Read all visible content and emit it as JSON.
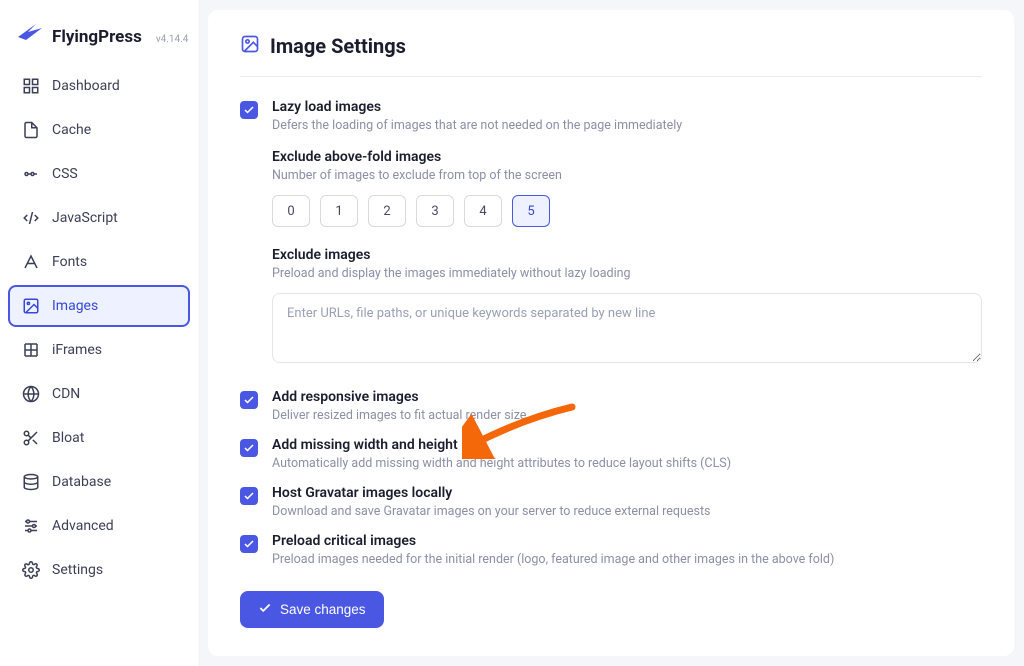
{
  "brand": {
    "name": "FlyingPress",
    "version": "v4.14.4"
  },
  "nav": [
    {
      "label": "Dashboard",
      "icon": "grid"
    },
    {
      "label": "Cache",
      "icon": "file"
    },
    {
      "label": "CSS",
      "icon": "css"
    },
    {
      "label": "JavaScript",
      "icon": "js"
    },
    {
      "label": "Fonts",
      "icon": "font"
    },
    {
      "label": "Images",
      "icon": "image",
      "active": true
    },
    {
      "label": "iFrames",
      "icon": "iframe"
    },
    {
      "label": "CDN",
      "icon": "globe"
    },
    {
      "label": "Bloat",
      "icon": "scissors"
    },
    {
      "label": "Database",
      "icon": "database"
    },
    {
      "label": "Advanced",
      "icon": "sliders"
    },
    {
      "label": "Settings",
      "icon": "gear"
    }
  ],
  "page": {
    "title": "Image Settings"
  },
  "settings": {
    "lazy": {
      "title": "Lazy load images",
      "desc": "Defers the loading of images that are not needed on the page immediately"
    },
    "exclude_above": {
      "label": "Exclude above-fold images",
      "hint": "Number of images to exclude from top of the screen",
      "options": [
        "0",
        "1",
        "2",
        "3",
        "4",
        "5"
      ],
      "selected": "5"
    },
    "exclude_images": {
      "label": "Exclude images",
      "hint": "Preload and display the images immediately without lazy loading",
      "placeholder": "Enter URLs, file paths, or unique keywords separated by new line"
    },
    "responsive": {
      "title": "Add responsive images",
      "desc": "Deliver resized images to fit actual render size"
    },
    "missing_wh": {
      "title": "Add missing width and height",
      "desc": "Automatically add missing width and height attributes to reduce layout shifts (CLS)"
    },
    "gravatar": {
      "title": "Host Gravatar images locally",
      "desc": "Download and save Gravatar images on your server to reduce external requests"
    },
    "preload": {
      "title": "Preload critical images",
      "desc": "Preload images needed for the initial render (logo, featured image and other images in the above fold)"
    }
  },
  "save_button": "Save changes",
  "annotation": {
    "arrow_color": "#f5680a"
  }
}
